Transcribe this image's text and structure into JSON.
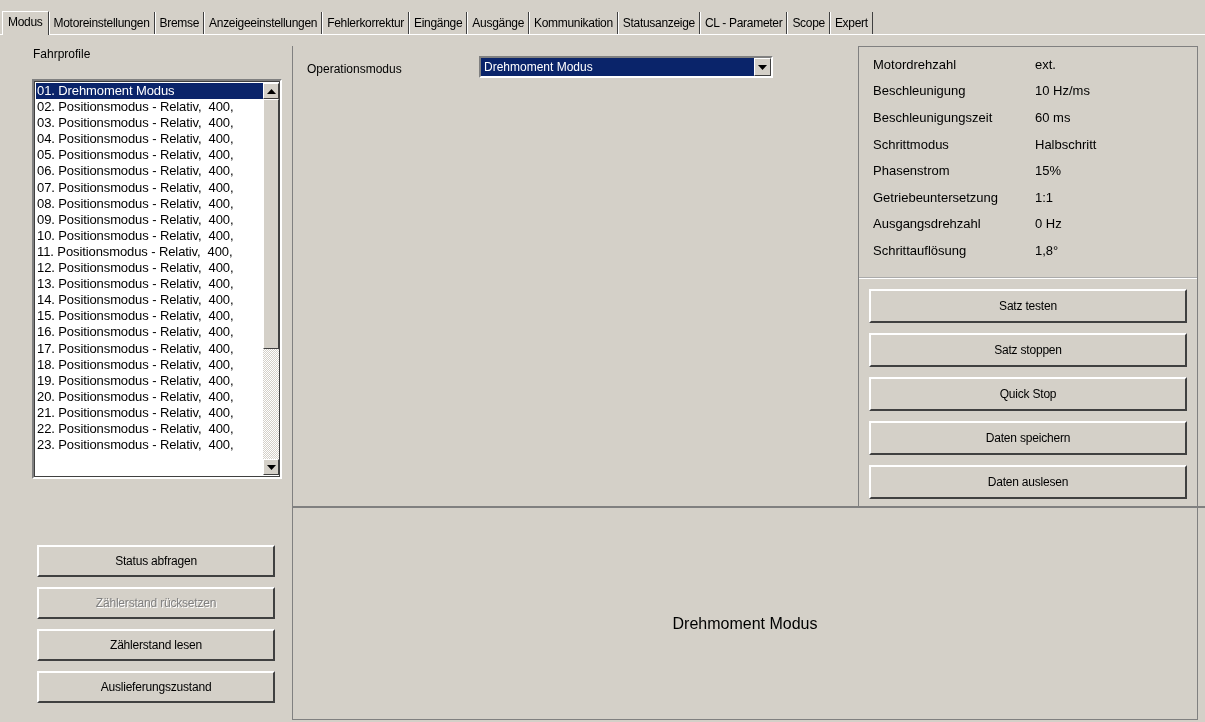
{
  "tabs": [
    {
      "label": "Modus",
      "selected": true
    },
    {
      "label": "Motoreinstellungen",
      "selected": false
    },
    {
      "label": "Bremse",
      "selected": false
    },
    {
      "label": "Anzeigeeinstellungen",
      "selected": false
    },
    {
      "label": "Fehlerkorrektur",
      "selected": false
    },
    {
      "label": "Eingänge",
      "selected": false
    },
    {
      "label": "Ausgänge",
      "selected": false
    },
    {
      "label": "Kommunikation",
      "selected": false
    },
    {
      "label": "Statusanzeige",
      "selected": false
    },
    {
      "label": "CL - Parameter",
      "selected": false
    },
    {
      "label": "Scope",
      "selected": false
    },
    {
      "label": "Expert",
      "selected": false
    }
  ],
  "profiles": {
    "label": "Fahrprofile",
    "items": [
      {
        "text": "01. Drehmoment Modus",
        "selected": true
      },
      {
        "text": "02. Positionsmodus - Relativ,  400,",
        "selected": false
      },
      {
        "text": "03. Positionsmodus - Relativ,  400,",
        "selected": false
      },
      {
        "text": "04. Positionsmodus - Relativ,  400,",
        "selected": false
      },
      {
        "text": "05. Positionsmodus - Relativ,  400,",
        "selected": false
      },
      {
        "text": "06. Positionsmodus - Relativ,  400,",
        "selected": false
      },
      {
        "text": "07. Positionsmodus - Relativ,  400,",
        "selected": false
      },
      {
        "text": "08. Positionsmodus - Relativ,  400,",
        "selected": false
      },
      {
        "text": "09. Positionsmodus - Relativ,  400,",
        "selected": false
      },
      {
        "text": "10. Positionsmodus - Relativ,  400,",
        "selected": false
      },
      {
        "text": "11. Positionsmodus - Relativ,  400,",
        "selected": false
      },
      {
        "text": "12. Positionsmodus - Relativ,  400,",
        "selected": false
      },
      {
        "text": "13. Positionsmodus - Relativ,  400,",
        "selected": false
      },
      {
        "text": "14. Positionsmodus - Relativ,  400,",
        "selected": false
      },
      {
        "text": "15. Positionsmodus - Relativ,  400,",
        "selected": false
      },
      {
        "text": "16. Positionsmodus - Relativ,  400,",
        "selected": false
      },
      {
        "text": "17. Positionsmodus - Relativ,  400,",
        "selected": false
      },
      {
        "text": "18. Positionsmodus - Relativ,  400,",
        "selected": false
      },
      {
        "text": "19. Positionsmodus - Relativ,  400,",
        "selected": false
      },
      {
        "text": "20. Positionsmodus - Relativ,  400,",
        "selected": false
      },
      {
        "text": "21. Positionsmodus - Relativ,  400,",
        "selected": false
      },
      {
        "text": "22. Positionsmodus - Relativ,  400,",
        "selected": false
      },
      {
        "text": "23. Positionsmodus - Relativ,  400,",
        "selected": false
      }
    ]
  },
  "left_buttons": [
    {
      "label": "Status abfragen",
      "disabled": false
    },
    {
      "label": "Zählerstand rücksetzen",
      "disabled": true
    },
    {
      "label": "Zählerstand lesen",
      "disabled": false
    },
    {
      "label": "Auslieferungszustand",
      "disabled": false
    }
  ],
  "operation_mode": {
    "label": "Operationsmodus",
    "value": "Drehmoment Modus"
  },
  "info": [
    {
      "label": "Motordrehzahl",
      "value": "ext."
    },
    {
      "label": "Beschleunigung",
      "value": "10 Hz/ms"
    },
    {
      "label": "Beschleunigungszeit",
      "value": "60 ms"
    },
    {
      "label": "Schrittmodus",
      "value": "Halbschritt"
    },
    {
      "label": "Phasenstrom",
      "value": "15%"
    },
    {
      "label": "Getriebeuntersetzung",
      "value": "1:1"
    },
    {
      "label": "Ausgangsdrehzahl",
      "value": "0 Hz"
    },
    {
      "label": "Schrittauflösung",
      "value": "1,8°"
    }
  ],
  "right_buttons": [
    "Satz testen",
    "Satz stoppen",
    "Quick Stop",
    "Daten speichern",
    "Daten auslesen"
  ],
  "mode_caption": "Drehmoment Modus"
}
